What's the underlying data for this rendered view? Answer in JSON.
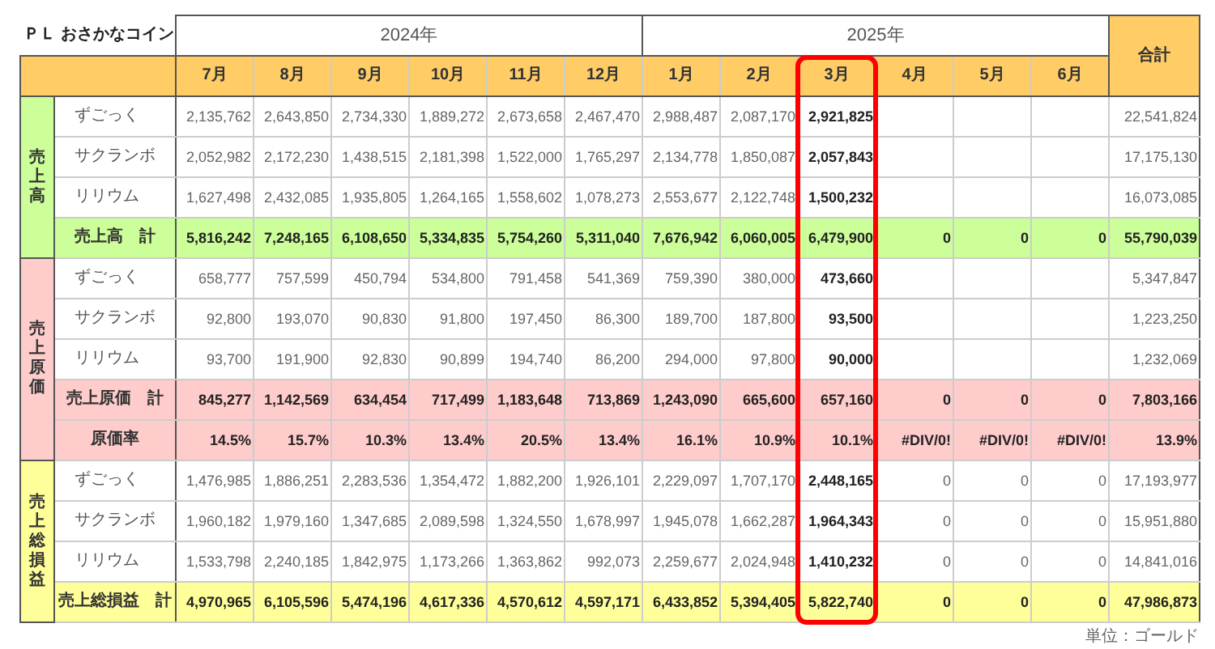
{
  "title": "ＰＬ おさかなコイン",
  "years": [
    {
      "label": "2024年",
      "months": [
        {
          "label": "7月",
          "highlighted": false
        },
        {
          "label": "8月",
          "highlighted": false
        },
        {
          "label": "9月",
          "highlighted": false
        },
        {
          "label": "10月",
          "highlighted": false
        },
        {
          "label": "11月",
          "highlighted": false
        },
        {
          "label": "12月",
          "highlighted": false
        }
      ]
    },
    {
      "label": "2025年",
      "months": [
        {
          "label": "1月",
          "highlighted": false
        },
        {
          "label": "2月",
          "highlighted": false
        },
        {
          "label": "3月",
          "highlighted": true
        },
        {
          "label": "4月",
          "highlighted": false
        },
        {
          "label": "5月",
          "highlighted": false
        },
        {
          "label": "6月",
          "highlighted": false
        }
      ]
    }
  ],
  "total_header": "合計",
  "sections": [
    {
      "label": "売上高",
      "kind": "sales",
      "rows": [
        {
          "kind": "item",
          "label": "ずごっく",
          "values": [
            "2,135,762",
            "2,643,850",
            "2,734,330",
            "1,889,272",
            "2,673,658",
            "2,467,470",
            "2,988,487",
            "2,087,170",
            "2,921,825"
          ],
          "total": "22,541,824"
        },
        {
          "kind": "item",
          "label": "サクランボ",
          "values": [
            "2,052,982",
            "2,172,230",
            "1,438,515",
            "2,181,398",
            "1,522,000",
            "1,765,297",
            "2,134,778",
            "1,850,087",
            "2,057,843"
          ],
          "total": "17,175,130"
        },
        {
          "kind": "item",
          "label": "リリウム",
          "values": [
            "1,627,498",
            "2,432,085",
            "1,935,805",
            "1,264,165",
            "1,558,602",
            "1,078,273",
            "2,553,677",
            "2,122,748",
            "1,500,232"
          ],
          "total": "16,073,085"
        },
        {
          "kind": "summary",
          "label": "売上高　計",
          "values": [
            "5,816,242",
            "7,248,165",
            "6,108,650",
            "5,334,835",
            "5,754,260",
            "5,311,040",
            "7,676,942",
            "6,060,005",
            "6,479,900",
            "0",
            "0",
            "0"
          ],
          "total": "55,790,039"
        }
      ]
    },
    {
      "label": "売上原価",
      "kind": "cost",
      "rows": [
        {
          "kind": "item",
          "label": "ずごっく",
          "values": [
            "658,777",
            "757,599",
            "450,794",
            "534,800",
            "791,458",
            "541,369",
            "759,390",
            "380,000",
            "473,660"
          ],
          "total": "5,347,847"
        },
        {
          "kind": "item",
          "label": "サクランボ",
          "values": [
            "92,800",
            "193,070",
            "90,830",
            "91,800",
            "197,450",
            "86,300",
            "189,700",
            "187,800",
            "93,500"
          ],
          "total": "1,223,250"
        },
        {
          "kind": "item",
          "label": "リリウム",
          "values": [
            "93,700",
            "191,900",
            "92,830",
            "90,899",
            "194,740",
            "86,200",
            "294,000",
            "97,800",
            "90,000"
          ],
          "total": "1,232,069"
        },
        {
          "kind": "summary",
          "label": "売上原価　計",
          "values": [
            "845,277",
            "1,142,569",
            "634,454",
            "717,499",
            "1,183,648",
            "713,869",
            "1,243,090",
            "665,600",
            "657,160",
            "0",
            "0",
            "0"
          ],
          "total": "7,803,166"
        },
        {
          "kind": "ratio",
          "label": "原価率",
          "values": [
            "14.5%",
            "15.7%",
            "10.3%",
            "13.4%",
            "20.5%",
            "13.4%",
            "16.1%",
            "10.9%",
            "10.1%",
            "#DIV/0!",
            "#DIV/0!",
            "#DIV/0!"
          ],
          "total": "13.9%"
        }
      ]
    },
    {
      "label": "売上総損益",
      "kind": "profit",
      "rows": [
        {
          "kind": "item",
          "label": "ずごっく",
          "values": [
            "1,476,985",
            "1,886,251",
            "2,283,536",
            "1,354,472",
            "1,882,200",
            "1,926,101",
            "2,229,097",
            "1,707,170",
            "2,448,165",
            "0",
            "0",
            "0"
          ],
          "total": "17,193,977"
        },
        {
          "kind": "item",
          "label": "サクランボ",
          "values": [
            "1,960,182",
            "1,979,160",
            "1,347,685",
            "2,089,598",
            "1,324,550",
            "1,678,997",
            "1,945,078",
            "1,662,287",
            "1,964,343",
            "0",
            "0",
            "0"
          ],
          "total": "15,951,880"
        },
        {
          "kind": "item",
          "label": "リリウム",
          "values": [
            "1,533,798",
            "2,240,185",
            "1,842,975",
            "1,173,266",
            "1,363,862",
            "992,073",
            "2,259,677",
            "2,024,948",
            "1,410,232",
            "0",
            "0",
            "0"
          ],
          "total": "14,841,016"
        },
        {
          "kind": "summary",
          "label": "売上総損益　計",
          "values": [
            "4,970,965",
            "6,105,596",
            "5,474,196",
            "4,617,336",
            "4,570,612",
            "4,597,171",
            "6,433,852",
            "5,394,405",
            "5,822,740",
            "0",
            "0",
            "0"
          ],
          "total": "47,986,873"
        }
      ]
    }
  ],
  "unit_note": "単位：ゴールド"
}
